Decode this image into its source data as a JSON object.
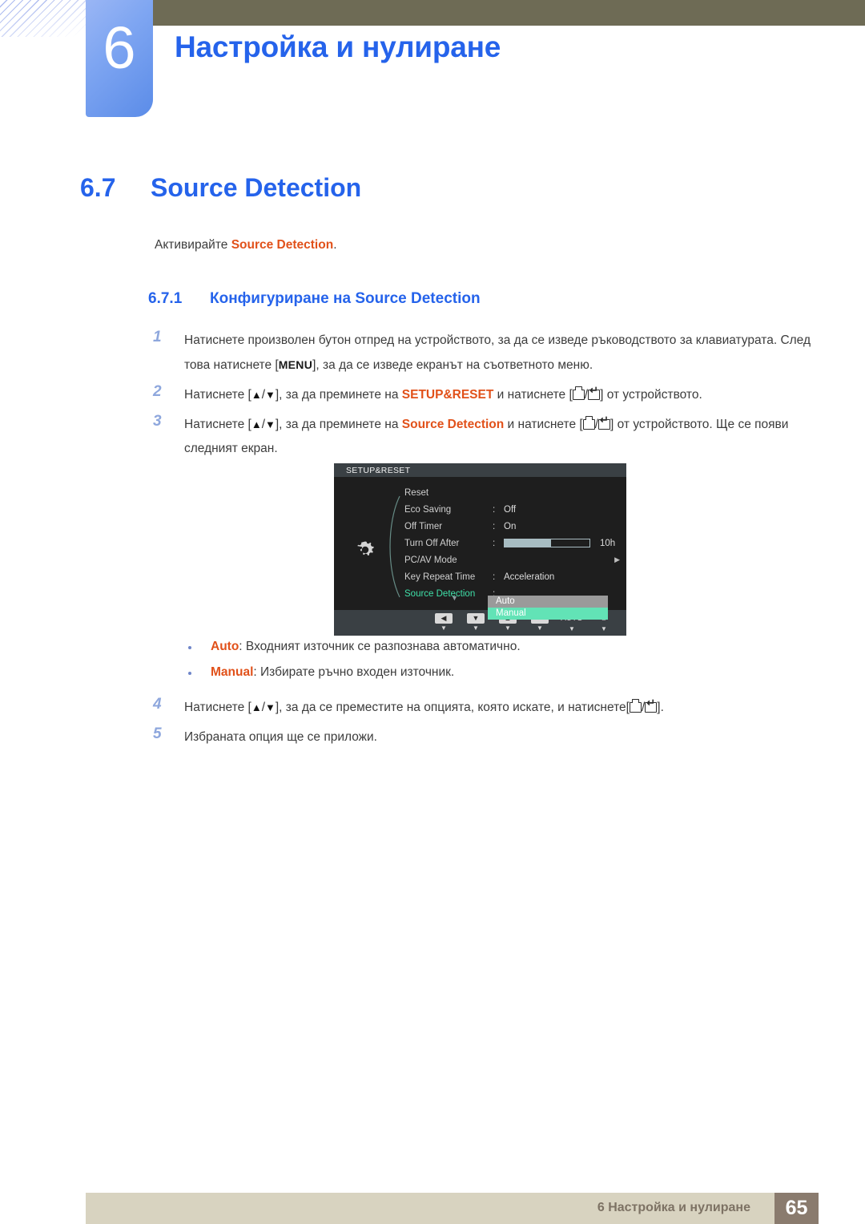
{
  "header": {
    "chapter_number": "6",
    "chapter_title": "Настройка и нулиране"
  },
  "section": {
    "number": "6.7",
    "title": "Source Detection",
    "lead_prefix": "Активирайте ",
    "lead_highlight": "Source Detection",
    "lead_suffix": ".",
    "subsection_number": "6.7.1",
    "subsection_title": "Конфигуриране на Source Detection"
  },
  "steps": [
    {
      "index": "1",
      "parts": [
        {
          "t": "text",
          "v": "Натиснете произволен бутон отпред на устройството, за да се изведе ръководството за клавиатурата. След това натиснете ["
        },
        {
          "t": "hard",
          "v": "MENU"
        },
        {
          "t": "text",
          "v": "], за да се изведе екранът на съответното меню."
        }
      ]
    },
    {
      "index": "2",
      "parts": [
        {
          "t": "text",
          "v": "Натиснете ["
        },
        {
          "t": "tri",
          "v": "▲"
        },
        {
          "t": "text",
          "v": "/"
        },
        {
          "t": "tri",
          "v": "▼"
        },
        {
          "t": "text",
          "v": "], за да преминете на "
        },
        {
          "t": "orange",
          "v": "SETUP&RESET"
        },
        {
          "t": "text",
          "v": " и натиснете ["
        },
        {
          "t": "key-tab",
          "v": ""
        },
        {
          "t": "text",
          "v": "/"
        },
        {
          "t": "key-ret",
          "v": ""
        },
        {
          "t": "text",
          "v": "] от устройството."
        }
      ]
    },
    {
      "index": "3",
      "parts": [
        {
          "t": "text",
          "v": "Натиснете ["
        },
        {
          "t": "tri",
          "v": "▲"
        },
        {
          "t": "text",
          "v": "/"
        },
        {
          "t": "tri",
          "v": "▼"
        },
        {
          "t": "text",
          "v": "], за да преминете на "
        },
        {
          "t": "orange",
          "v": "Source Detection"
        },
        {
          "t": "text",
          "v": " и натиснете ["
        },
        {
          "t": "key-tab",
          "v": ""
        },
        {
          "t": "text",
          "v": "/"
        },
        {
          "t": "key-ret",
          "v": ""
        },
        {
          "t": "text",
          "v": "] от устройството. Ще се появи следният екран."
        }
      ]
    }
  ],
  "bullets": [
    {
      "label": "Auto",
      "text": ": Входният източник се разпознава автоматично."
    },
    {
      "label": "Manual",
      "text": ": Избирате ръчно входен източник."
    }
  ],
  "steps2": [
    {
      "index": "4",
      "parts": [
        {
          "t": "text",
          "v": "Натиснете ["
        },
        {
          "t": "tri",
          "v": "▲"
        },
        {
          "t": "text",
          "v": "/"
        },
        {
          "t": "tri",
          "v": "▼"
        },
        {
          "t": "text",
          "v": "], за да се преместите на опцията, която искате, и натиснете["
        },
        {
          "t": "key-tab",
          "v": ""
        },
        {
          "t": "text",
          "v": "/"
        },
        {
          "t": "key-ret",
          "v": ""
        },
        {
          "t": "text",
          "v": "]."
        }
      ]
    },
    {
      "index": "5",
      "parts": [
        {
          "t": "text",
          "v": "Избраната опция ще се приложи."
        }
      ]
    }
  ],
  "osd": {
    "title": "SETUP&RESET",
    "icon": "gear-icon",
    "rows": [
      {
        "label": "Reset",
        "colon": "",
        "value": "",
        "kind": "plain"
      },
      {
        "label": "Eco Saving",
        "colon": ":",
        "value": "Off",
        "kind": "plain"
      },
      {
        "label": "Off Timer",
        "colon": ":",
        "value": "On",
        "kind": "plain"
      },
      {
        "label": "Turn Off After",
        "colon": ":",
        "value": "10h",
        "kind": "slider",
        "slider_percent": 55
      },
      {
        "label": "PC/AV Mode",
        "colon": "",
        "value": "",
        "kind": "submenu",
        "arrow": "▶"
      },
      {
        "label": "Key Repeat Time",
        "colon": ":",
        "value": "Acceleration",
        "kind": "plain"
      },
      {
        "label": "Source Detection",
        "colon": ":",
        "value": "",
        "kind": "selected"
      }
    ],
    "scroll_down_indicator": "▼",
    "dropdown": {
      "options": [
        "Auto",
        "Manual"
      ],
      "highlighted": "Manual",
      "auto_bg": "#9a9a9a",
      "manual_bg": "#62e3b6"
    },
    "buttons": [
      {
        "glyph": "◀",
        "name": "left-button",
        "sub": "▼",
        "plain": false
      },
      {
        "glyph": "▼",
        "name": "down-button",
        "sub": "▼",
        "plain": false
      },
      {
        "glyph": "▲",
        "name": "up-button",
        "sub": "▼",
        "plain": false
      },
      {
        "glyph": "↵",
        "name": "enter-button",
        "sub": "▼",
        "plain": false
      },
      {
        "glyph": "AUTO",
        "name": "auto-button",
        "sub": "▼",
        "plain": true
      },
      {
        "glyph": "⏻",
        "name": "power-button",
        "sub": "▼",
        "plain": true
      }
    ]
  },
  "footer": {
    "text": "6 Настройка и нулиране",
    "page": "65"
  }
}
